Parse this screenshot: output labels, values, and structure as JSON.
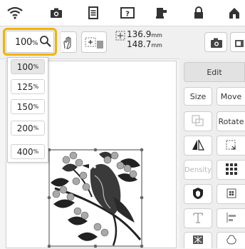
{
  "status_bar": {
    "icons": [
      "wifi-icon",
      "camera-icon",
      "document-icon",
      "help-icon",
      "thread-icon",
      "home-icon",
      "arrow-icon"
    ]
  },
  "toolbar": {
    "zoom_value": "100",
    "zoom_unit": "%",
    "width_value": "136.9",
    "height_value": "148.7",
    "dim_unit": "mm",
    "highlight_color": "#f0b400"
  },
  "zoom_menu": {
    "options": [
      {
        "value": "100",
        "unit": "%",
        "selected": true
      },
      {
        "value": "125",
        "unit": "%",
        "selected": false
      },
      {
        "value": "150",
        "unit": "%",
        "selected": false
      },
      {
        "value": "200",
        "unit": "%",
        "selected": false
      },
      {
        "value": "400",
        "unit": "%",
        "selected": false
      }
    ]
  },
  "edit_panel": {
    "tab_label": "Edit",
    "size_label": "Size",
    "move_label": "Move",
    "rotate_label": "Rotate",
    "density_label": "Density"
  }
}
